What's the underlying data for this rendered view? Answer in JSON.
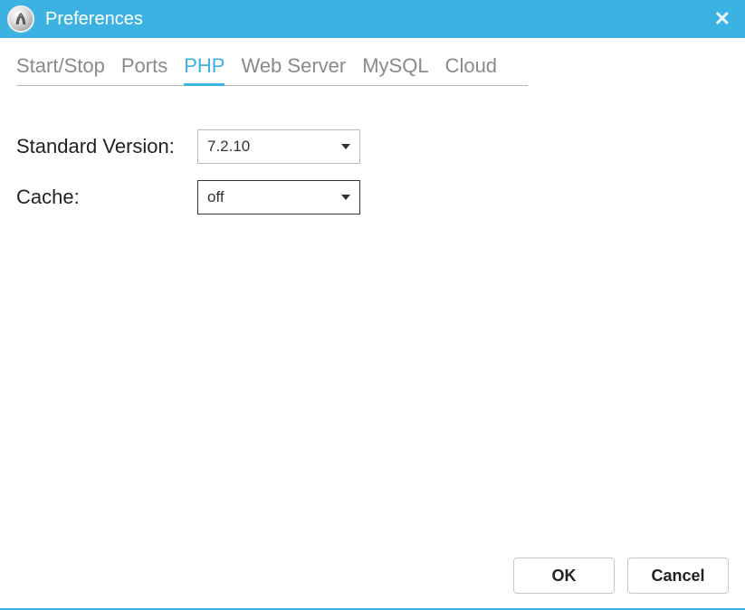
{
  "window": {
    "title": "Preferences"
  },
  "tabs": [
    {
      "label": "Start/Stop",
      "active": false
    },
    {
      "label": "Ports",
      "active": false
    },
    {
      "label": "PHP",
      "active": true
    },
    {
      "label": "Web Server",
      "active": false
    },
    {
      "label": "MySQL",
      "active": false
    },
    {
      "label": "Cloud",
      "active": false
    }
  ],
  "form": {
    "standardVersion": {
      "label": "Standard Version:",
      "value": "7.2.10"
    },
    "cache": {
      "label": "Cache:",
      "value": "off"
    }
  },
  "buttons": {
    "ok": "OK",
    "cancel": "Cancel"
  }
}
